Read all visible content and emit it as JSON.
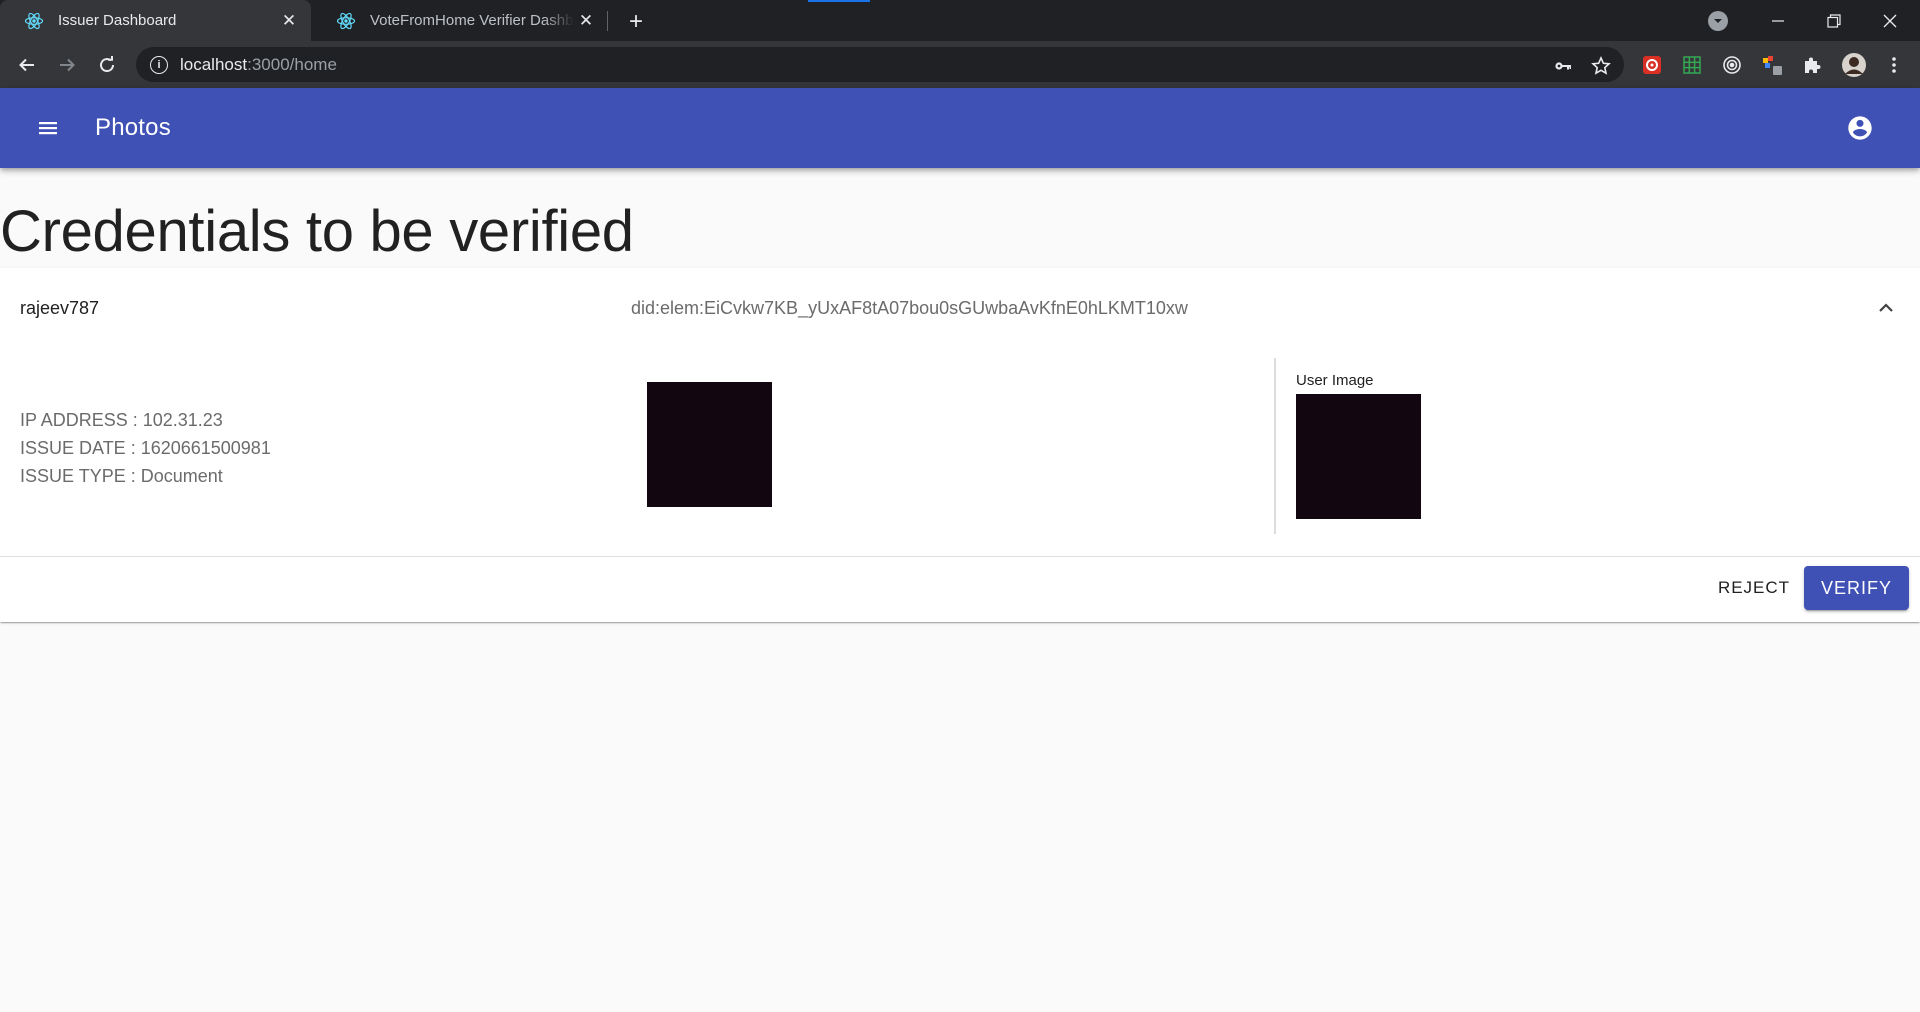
{
  "browser": {
    "tabs": [
      {
        "title": "Issuer Dashboard",
        "active": true,
        "favicon": "react-icon"
      },
      {
        "title": "VoteFromHome Verifier Dashboard",
        "active": false,
        "favicon": "react-icon"
      }
    ],
    "url_host": "localhost",
    "url_path": ":3000/home"
  },
  "app": {
    "title": "Photos",
    "primary_color": "#3f51b5"
  },
  "page": {
    "heading": "Credentials to be verified"
  },
  "credential": {
    "username": "rajeev787",
    "did": "did:elem:EiCvkw7KB_yUxAF8tA07bou0sGUwbaAvKfnE0hLKMT10xw",
    "ip_address": "IP ADDRESS : 102.31.23",
    "issue_date": "ISSUE DATE : 1620661500981",
    "issue_type": "ISSUE TYPE : Document",
    "user_image_label": "User Image",
    "actions": {
      "reject_label": "REJECT",
      "verify_label": "VERIFY"
    }
  }
}
